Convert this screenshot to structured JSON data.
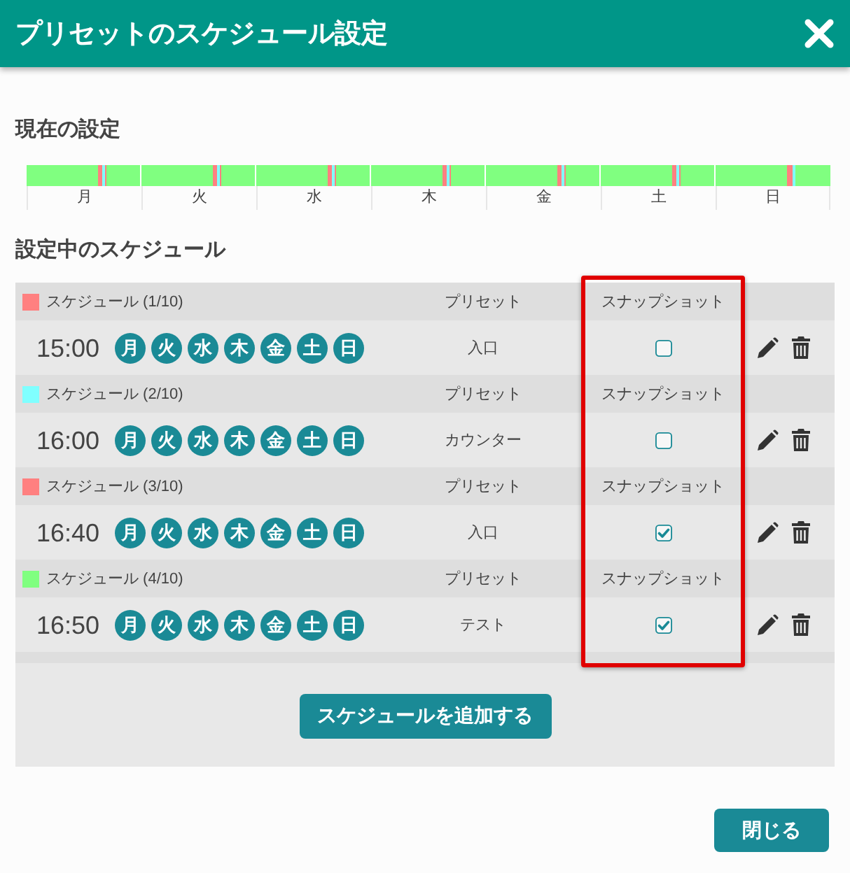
{
  "dialog": {
    "title": "プリセットのスケジュール設定"
  },
  "current": {
    "heading": "現在の設定",
    "timeline_days": [
      "月",
      "火",
      "水",
      "木",
      "金",
      "土",
      "日"
    ]
  },
  "schedule_section": {
    "heading": "設定中のスケジュール",
    "highlight_snapshot_column": true
  },
  "schedules": [
    {
      "label": "スケジュール (1/10)",
      "color": "#ff8080",
      "time": "15:00",
      "days": [
        {
          "label": "月",
          "selected": true
        },
        {
          "label": "火",
          "selected": true
        },
        {
          "label": "水",
          "selected": true
        },
        {
          "label": "木",
          "selected": true
        },
        {
          "label": "金",
          "selected": true
        },
        {
          "label": "土",
          "selected": true
        },
        {
          "label": "日",
          "selected": true
        }
      ],
      "preset_heading": "プリセット",
      "preset": "入口",
      "snapshot_heading": "スナップショット",
      "snapshot_checked": false
    },
    {
      "label": "スケジュール (2/10)",
      "color": "#80ffff",
      "time": "16:00",
      "days": [
        {
          "label": "月",
          "selected": true
        },
        {
          "label": "火",
          "selected": true
        },
        {
          "label": "水",
          "selected": true
        },
        {
          "label": "木",
          "selected": true
        },
        {
          "label": "金",
          "selected": true
        },
        {
          "label": "土",
          "selected": true
        },
        {
          "label": "日",
          "selected": true
        }
      ],
      "preset_heading": "プリセット",
      "preset": "カウンター",
      "snapshot_heading": "スナップショット",
      "snapshot_checked": false
    },
    {
      "label": "スケジュール (3/10)",
      "color": "#ff8080",
      "time": "16:40",
      "days": [
        {
          "label": "月",
          "selected": true
        },
        {
          "label": "火",
          "selected": true
        },
        {
          "label": "水",
          "selected": true
        },
        {
          "label": "木",
          "selected": true
        },
        {
          "label": "金",
          "selected": true
        },
        {
          "label": "土",
          "selected": true
        },
        {
          "label": "日",
          "selected": true
        }
      ],
      "preset_heading": "プリセット",
      "preset": "入口",
      "snapshot_heading": "スナップショット",
      "snapshot_checked": true
    },
    {
      "label": "スケジュール (4/10)",
      "color": "#80ff80",
      "time": "16:50",
      "days": [
        {
          "label": "月",
          "selected": true
        },
        {
          "label": "火",
          "selected": true
        },
        {
          "label": "水",
          "selected": true
        },
        {
          "label": "木",
          "selected": true
        },
        {
          "label": "金",
          "selected": true
        },
        {
          "label": "土",
          "selected": true
        },
        {
          "label": "日",
          "selected": true
        }
      ],
      "preset_heading": "プリセット",
      "preset": "テスト",
      "snapshot_heading": "スナップショット",
      "snapshot_checked": true
    }
  ],
  "add_button": "スケジュールを追加する",
  "close_button": "閉じる"
}
